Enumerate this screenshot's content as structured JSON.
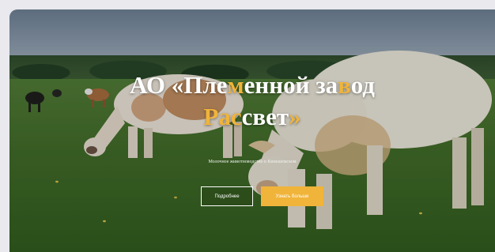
{
  "hero": {
    "title_prefix": "АО «Пле",
    "title_hl1": "м",
    "title_mid": "енной за",
    "title_hl2": "в",
    "title_end": "од",
    "title_line2_hl": "Ра",
    "title_line2_hl2": "с",
    "title_line2_mid": "свет",
    "title_line2_close": "»",
    "subtitle": "Молочное животноводство в Кинешемском",
    "button_more": "Подробнее",
    "button_contact": "Узнать больше"
  },
  "colors": {
    "accent": "#f0b43a",
    "text": "#ffffff"
  }
}
